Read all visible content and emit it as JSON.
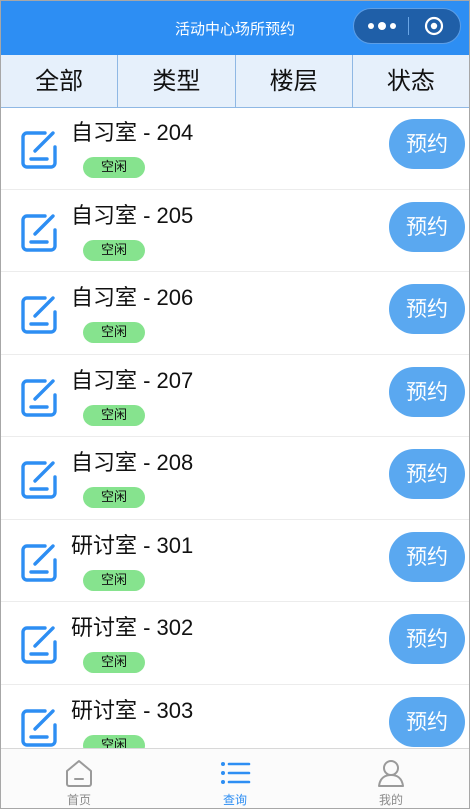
{
  "nav": {
    "title": "活动中心场所预约"
  },
  "filters": [
    {
      "label": "全部"
    },
    {
      "label": "类型"
    },
    {
      "label": "楼层"
    },
    {
      "label": "状态"
    }
  ],
  "rooms": [
    {
      "name": "自习室 - 204",
      "status": "空闲",
      "action": "预约"
    },
    {
      "name": "自习室 - 205",
      "status": "空闲",
      "action": "预约"
    },
    {
      "name": "自习室 - 206",
      "status": "空闲",
      "action": "预约"
    },
    {
      "name": "自习室 - 207",
      "status": "空闲",
      "action": "预约"
    },
    {
      "name": "自习室 - 208",
      "status": "空闲",
      "action": "预约"
    },
    {
      "name": "研讨室 - 301",
      "status": "空闲",
      "action": "预约"
    },
    {
      "name": "研讨室 - 302",
      "status": "空闲",
      "action": "预约"
    },
    {
      "name": "研讨室 - 303",
      "status": "空闲",
      "action": "预约"
    }
  ],
  "tabbar": [
    {
      "label": "首页",
      "icon": "home-icon",
      "active": false
    },
    {
      "label": "查询",
      "icon": "list-icon",
      "active": true
    },
    {
      "label": "我的",
      "icon": "user-icon",
      "active": false
    }
  ],
  "colors": {
    "primary": "#2d8ef3",
    "button": "#5aa8f0",
    "badge": "#86e38e",
    "filter_bg": "#e6f0fb"
  }
}
